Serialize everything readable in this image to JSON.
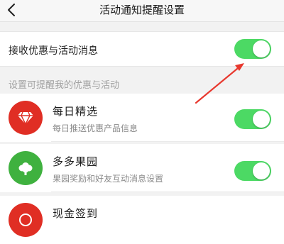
{
  "header": {
    "title": "活动通知提醒设置",
    "back_icon": "chevron-left-icon"
  },
  "master_toggle": {
    "label": "接收优惠与活动消息",
    "on": true
  },
  "section": {
    "title": "设置可提醒我的优惠与活动"
  },
  "items": [
    {
      "title": "每日精选",
      "subtitle": "每日推送优惠产品信息",
      "icon": "diamond-icon",
      "icon_color": "#e02e24",
      "on": true
    },
    {
      "title": "多多果园",
      "subtitle": "果园奖励和好友互动消息设置",
      "icon": "tree-icon",
      "icon_color": "#3fb13f",
      "on": true
    },
    {
      "title": "现金签到",
      "icon": "cash-icon",
      "icon_color": "#e02e24"
    }
  ],
  "colors": {
    "toggle_on": "#4cd964",
    "accent_red": "#e02e24",
    "annotation_arrow": "#e8382e"
  }
}
